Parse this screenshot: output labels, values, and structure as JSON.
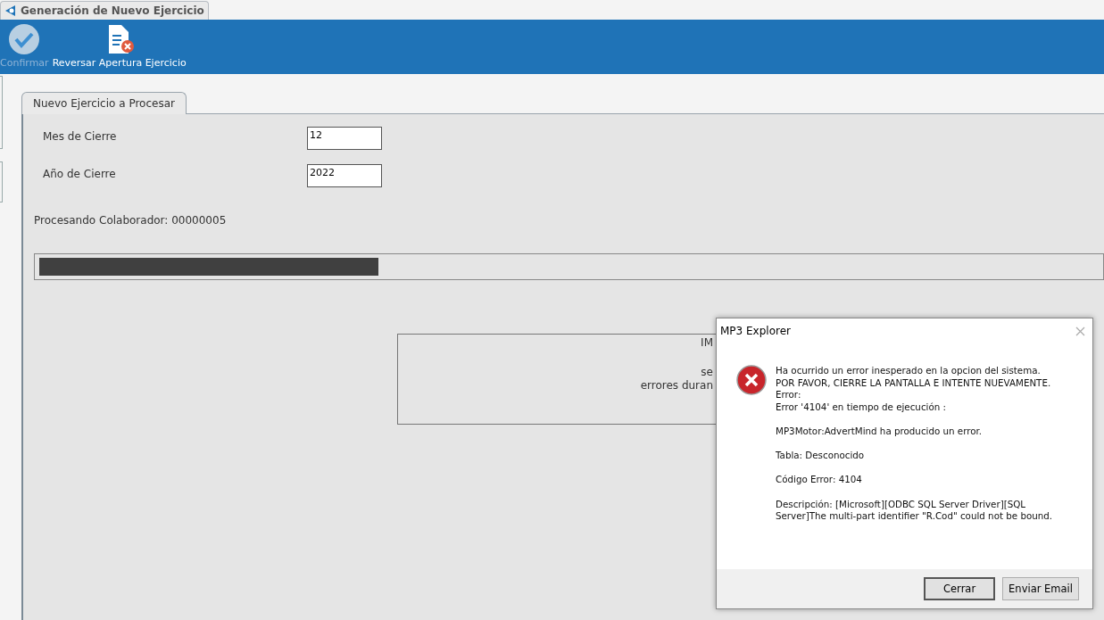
{
  "window": {
    "tab_title": "Generación de Nuevo Ejercicio"
  },
  "toolbar": [
    {
      "label": "Confirmar",
      "kind": "confirm",
      "disabled": true
    },
    {
      "label": "Reversar Apertura Ejercicio",
      "kind": "reverse",
      "disabled": false
    }
  ],
  "panel": {
    "tab": "Nuevo Ejercicio a Procesar",
    "fields": [
      {
        "label": "Mes de Cierre",
        "value": "12"
      },
      {
        "label": "Año de Cierre",
        "value": "2022"
      }
    ],
    "status": "Procesando Colaborador: 00000005",
    "progress": {
      "level": 0.32
    },
    "notice_lines": [
      "IM",
      "se",
      "errores duran"
    ]
  },
  "dialog": {
    "title": "MP3 Explorer",
    "message_paragraphs": [
      [
        "Ha ocurrido un error inesperado en la opcion del sistema.",
        "POR FAVOR, CIERRE LA PANTALLA E INTENTE NUEVAMENTE.",
        "Error:",
        "Error '4104' en tiempo de ejecución :"
      ],
      [
        "MP3Motor:AdvertMind ha producido un error."
      ],
      [
        "Tabla: Desconocido"
      ],
      [
        "Código Error: 4104"
      ],
      [
        "Descripción: [Microsoft][ODBC SQL Server Driver][SQL",
        "Server]The multi-part identifier \"R.Cod\" could not be bound."
      ]
    ],
    "buttons": [
      {
        "label": "Cerrar",
        "selected": true
      },
      {
        "label": "Enviar Email",
        "selected": false
      }
    ]
  }
}
